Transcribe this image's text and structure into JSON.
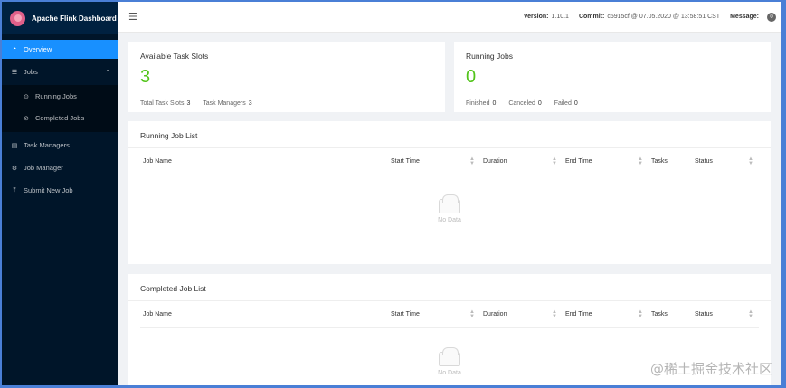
{
  "app": {
    "title": "Apache Flink Dashboard"
  },
  "sidebar": {
    "items": [
      {
        "label": "Overview",
        "icon": "dashboard-icon",
        "active": true
      },
      {
        "label": "Jobs",
        "icon": "list-icon",
        "expanded": true
      },
      {
        "label": "Running Jobs",
        "icon": "play-circle-icon"
      },
      {
        "label": "Completed Jobs",
        "icon": "check-circle-icon"
      },
      {
        "label": "Task Managers",
        "icon": "schedule-icon"
      },
      {
        "label": "Job Manager",
        "icon": "build-icon"
      },
      {
        "label": "Submit New Job",
        "icon": "upload-icon"
      }
    ]
  },
  "header": {
    "version_label": "Version:",
    "version_value": "1.10.1",
    "commit_label": "Commit:",
    "commit_value": "c5915cf @ 07.05.2020 @ 13:58:51 CST",
    "message_label": "Message:",
    "message_count": "0"
  },
  "overview": {
    "slots": {
      "title": "Available Task Slots",
      "value": "3",
      "total_label": "Total Task Slots",
      "total_value": "3",
      "tm_label": "Task Managers",
      "tm_value": "3"
    },
    "jobs": {
      "title": "Running Jobs",
      "value": "0",
      "finished_label": "Finished",
      "finished_value": "0",
      "canceled_label": "Canceled",
      "canceled_value": "0",
      "failed_label": "Failed",
      "failed_value": "0"
    }
  },
  "running_list": {
    "title": "Running Job List",
    "columns": [
      "Job Name",
      "Start Time",
      "Duration",
      "End Time",
      "Tasks",
      "Status"
    ],
    "empty_text": "No Data"
  },
  "completed_list": {
    "title": "Completed Job List",
    "columns": [
      "Job Name",
      "Start Time",
      "Duration",
      "End Time",
      "Tasks",
      "Status"
    ],
    "empty_text": "No Data"
  },
  "watermark": "@稀土掘金技术社区",
  "colors": {
    "accent": "#1890ff",
    "sidebar": "#001529",
    "success": "#52c41a"
  }
}
